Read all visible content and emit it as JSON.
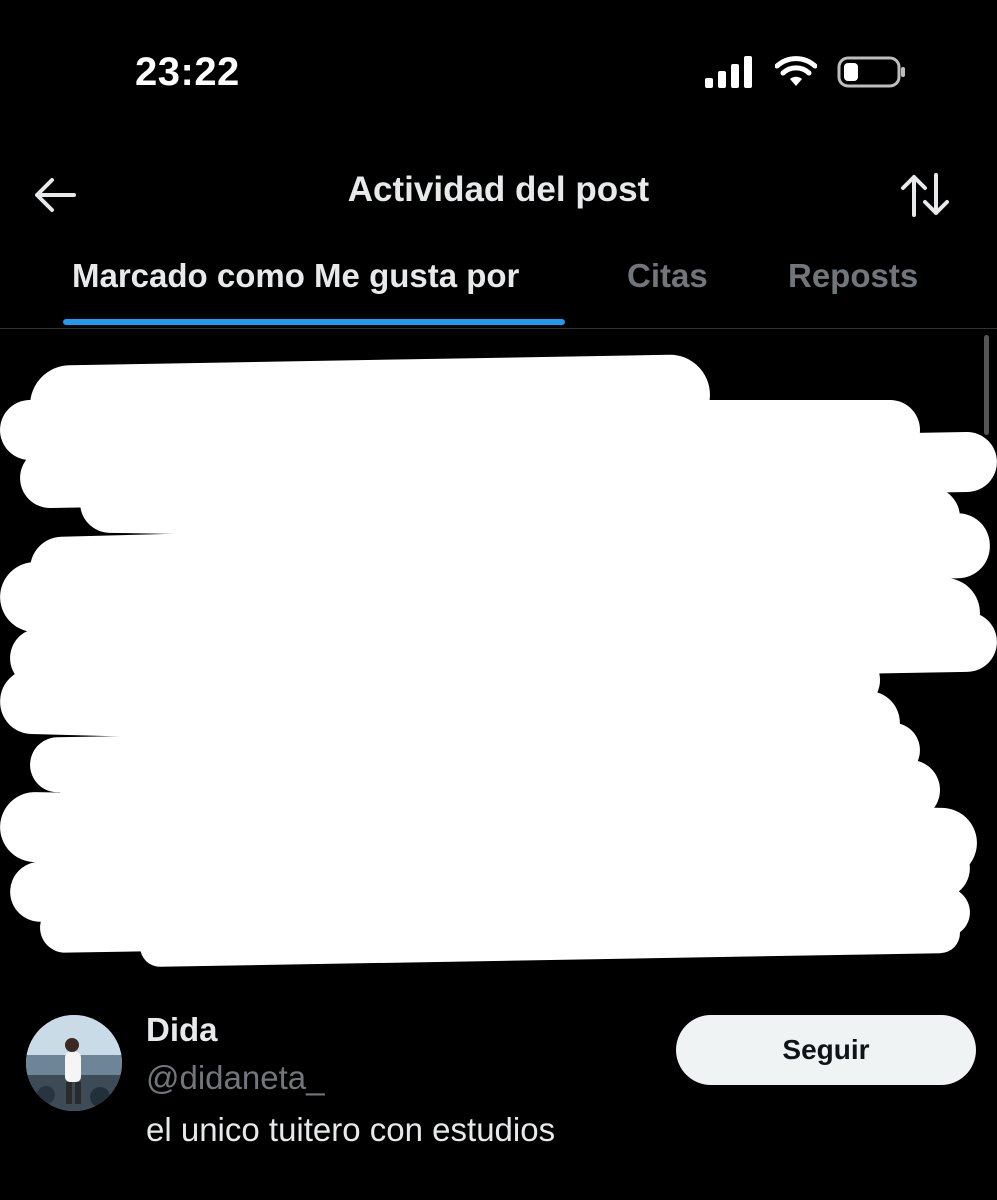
{
  "status_bar": {
    "time": "23:22",
    "icons": [
      "signal-icon",
      "wifi-icon",
      "battery-icon"
    ]
  },
  "header": {
    "title": "Actividad del post",
    "back_icon": "arrow-left-icon",
    "sort_icon": "sort-arrows-icon"
  },
  "tabs": [
    {
      "label": "Marcado como Me gusta por",
      "active": true
    },
    {
      "label": "Citas",
      "active": false
    },
    {
      "label": "Reposts",
      "active": false
    }
  ],
  "users": [
    {
      "display_name": "Dida",
      "handle": "@didaneta_",
      "bio": "el unico tuitero con estudios",
      "follow_label": "Seguir"
    }
  ],
  "colors": {
    "background": "#000000",
    "accent": "#1d9bf0",
    "primary_text": "#e7e9ea",
    "secondary_text": "#71767b",
    "follow_button_bg": "#eff3f4"
  }
}
